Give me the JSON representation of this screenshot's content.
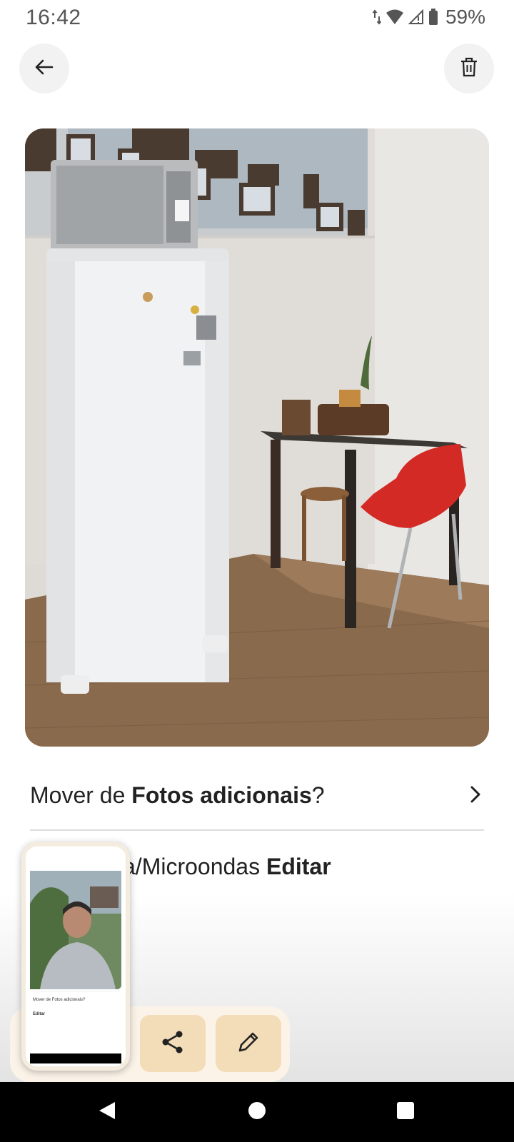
{
  "status_bar": {
    "time": "16:42",
    "battery": "59%",
    "icons": [
      "data-arrows-icon",
      "wifi-icon",
      "signal-icon",
      "battery-icon"
    ]
  },
  "toolbar": {
    "back_icon": "arrow-left-icon",
    "delete_icon": "trash-icon"
  },
  "photo": {
    "subject": "kitchen-room-photo",
    "icon": "image"
  },
  "move_row": {
    "prefix": "Mover de ",
    "album": "Fotos adicionais",
    "suffix": "?",
    "chevron_icon": "chevron-right-icon"
  },
  "caption_row": {
    "visible_caption": "a/Microondas ",
    "edit_label": "Editar"
  },
  "action_bar": {
    "share_icon": "share-icon",
    "edit_icon": "pencil-icon"
  },
  "thumbnail": {
    "move_text": "Mover de Fotos adicionais?",
    "edit_text": "Editar"
  },
  "nav_bar": {
    "icons": [
      "nav-back-icon",
      "nav-home-icon",
      "nav-recents-icon"
    ]
  },
  "colors": {
    "action_bar_bg": "#fbf3e8",
    "action_button_bg": "#f3dcb8",
    "text_primary": "#222222"
  }
}
